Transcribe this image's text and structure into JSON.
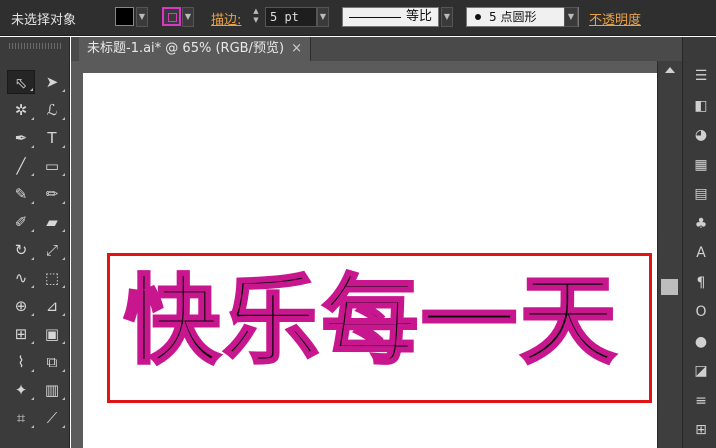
{
  "control_bar": {
    "selection_label": "未选择对象",
    "stroke_label": "描边:",
    "stroke_weight": "5 pt",
    "profile_label": "等比",
    "brush_label": "5 点圆形",
    "opacity_label": "不透明度",
    "colors": {
      "fill": "#000000",
      "stroke": "#d838c4",
      "link": "#e8a14a"
    }
  },
  "document": {
    "tab_title": "未标题-1.ai* @ 65% (RGB/预览)",
    "close_glyph": "×"
  },
  "artboard": {
    "text": "快乐每一天",
    "text_fill": "#0a0a0a",
    "text_stroke": "#c8168f",
    "highlight_box_color": "#e01414"
  },
  "tools": [
    {
      "name": "selection-tool-icon",
      "glyph": "⬁"
    },
    {
      "name": "direct-selection-tool-icon",
      "glyph": "➤"
    },
    {
      "name": "magic-wand-tool-icon",
      "glyph": "✲"
    },
    {
      "name": "lasso-tool-icon",
      "glyph": "ℒ"
    },
    {
      "name": "pen-tool-icon",
      "glyph": "✒"
    },
    {
      "name": "type-tool-icon",
      "glyph": "T"
    },
    {
      "name": "line-tool-icon",
      "glyph": "╱"
    },
    {
      "name": "rectangle-tool-icon",
      "glyph": "▭"
    },
    {
      "name": "paintbrush-tool-icon",
      "glyph": "✎"
    },
    {
      "name": "pencil-tool-icon",
      "glyph": "✏"
    },
    {
      "name": "blob-brush-tool-icon",
      "glyph": "✐"
    },
    {
      "name": "eraser-tool-icon",
      "glyph": "▰"
    },
    {
      "name": "rotate-tool-icon",
      "glyph": "↻"
    },
    {
      "name": "scale-tool-icon",
      "glyph": "⤢"
    },
    {
      "name": "warp-tool-icon",
      "glyph": "∿"
    },
    {
      "name": "free-transform-tool-icon",
      "glyph": "⬚"
    },
    {
      "name": "shape-builder-tool-icon",
      "glyph": "⊕"
    },
    {
      "name": "perspective-grid-tool-icon",
      "glyph": "⊿"
    },
    {
      "name": "mesh-tool-icon",
      "glyph": "⊞"
    },
    {
      "name": "gradient-tool-icon",
      "glyph": "▣"
    },
    {
      "name": "eyedropper-tool-icon",
      "glyph": "⌇"
    },
    {
      "name": "blend-tool-icon",
      "glyph": "⧉"
    },
    {
      "name": "symbol-sprayer-tool-icon",
      "glyph": "✦"
    },
    {
      "name": "column-graph-tool-icon",
      "glyph": "▥"
    },
    {
      "name": "artboard-tool-icon",
      "glyph": "⌗"
    },
    {
      "name": "slice-tool-icon",
      "glyph": "⟋"
    }
  ],
  "panels": [
    {
      "name": "panel-menu-icon",
      "glyph": "☰"
    },
    {
      "name": "color-panel-icon",
      "glyph": "◧"
    },
    {
      "name": "color-guide-panel-icon",
      "glyph": "◕"
    },
    {
      "name": "swatches-panel-icon",
      "glyph": "▦"
    },
    {
      "name": "brushes-panel-icon",
      "glyph": "▤"
    },
    {
      "name": "symbols-panel-icon",
      "glyph": "♣"
    },
    {
      "name": "character-panel-icon",
      "glyph": "A"
    },
    {
      "name": "paragraph-panel-icon",
      "glyph": "¶"
    },
    {
      "name": "opentype-panel-icon",
      "glyph": "O"
    },
    {
      "name": "appearance-panel-icon",
      "glyph": "●"
    },
    {
      "name": "graphic-styles-panel-icon",
      "glyph": "◪"
    },
    {
      "name": "layers-panel-icon",
      "glyph": "≡"
    },
    {
      "name": "artboards-panel-icon",
      "glyph": "⊞"
    }
  ]
}
